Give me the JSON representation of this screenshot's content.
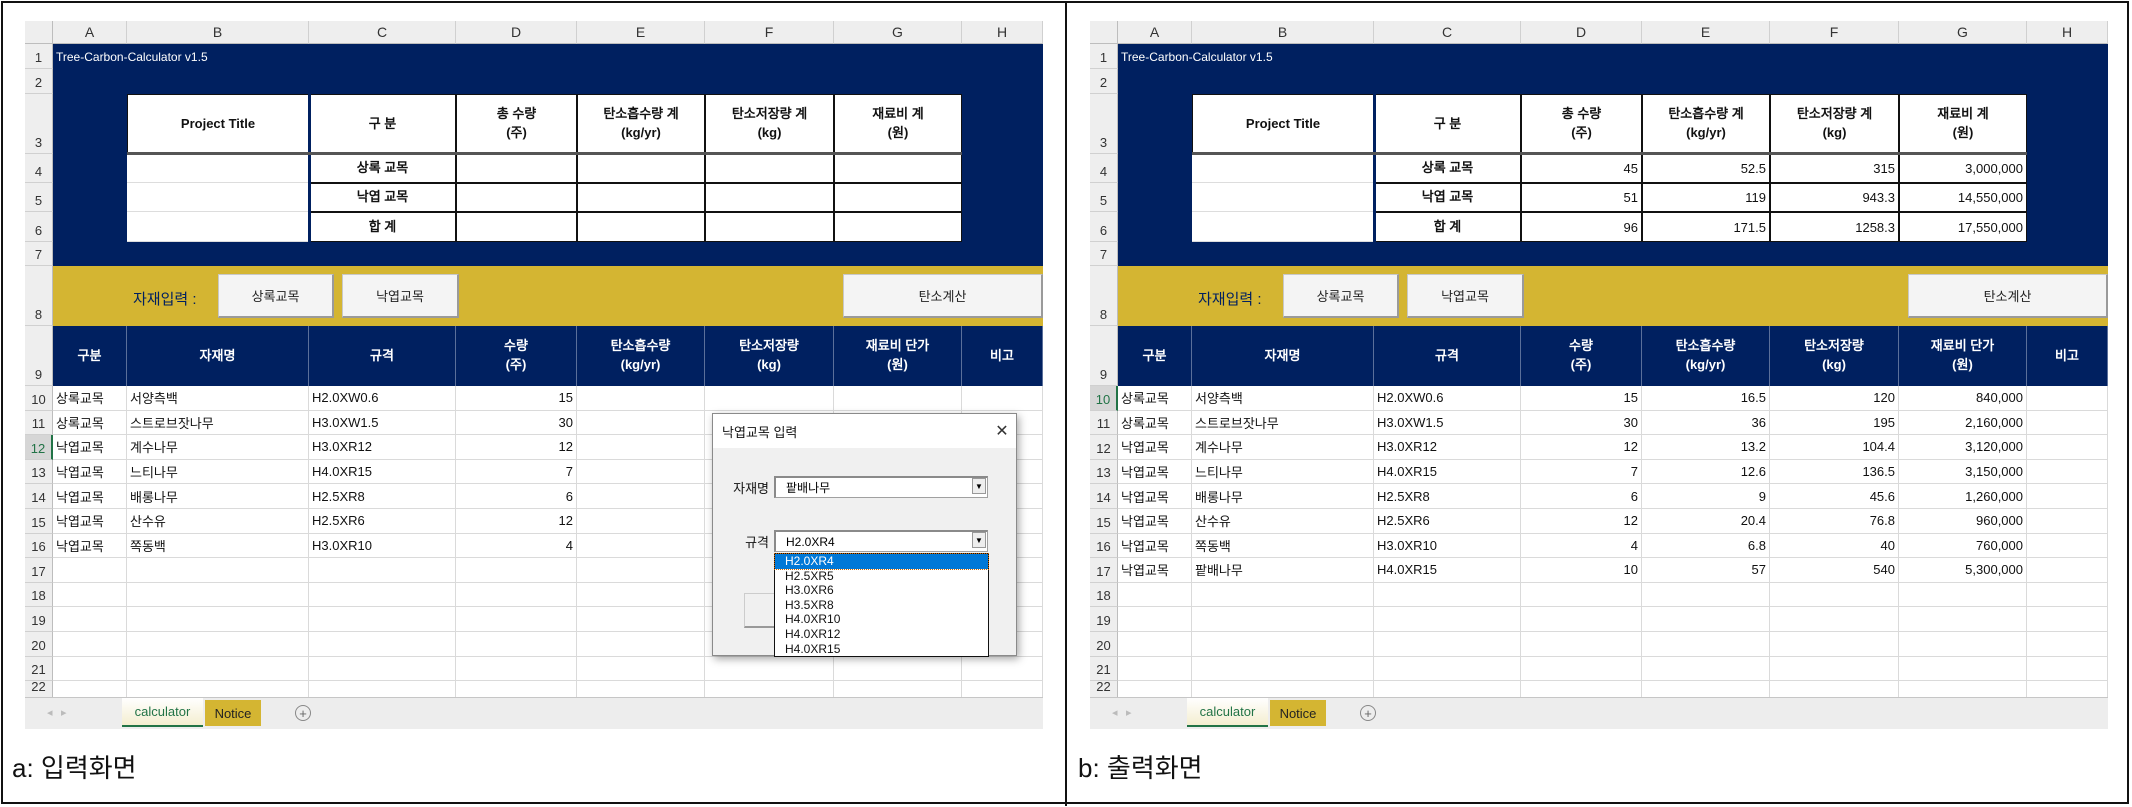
{
  "sheet": {
    "app_title": "Tree-Carbon-Calculator v1.5",
    "column_letters": [
      "A",
      "B",
      "C",
      "D",
      "E",
      "F",
      "G",
      "H"
    ],
    "summary_headers": [
      "Project Title",
      "구 분",
      "총 수량\n(주)",
      "탄소흡수량 계\n(kg/yr)",
      "탄소저장량 계\n(kg)",
      "재료비 계\n(원)"
    ],
    "summary_row_labels": [
      "상록 교목",
      "낙엽 교목",
      "합 계"
    ],
    "input_label": "자재입력 :",
    "buttons": {
      "evergreen": "상록교목",
      "deciduous": "낙엽교목",
      "calculate": "탄소계산"
    },
    "table_headers": [
      "구분",
      "자재명",
      "규격",
      "수량\n(주)",
      "탄소흡수량\n(kg/yr)",
      "탄소저장량\n(kg)",
      "재료비 단가\n(원)",
      "비고"
    ],
    "tabs": [
      "calculator",
      "Notice"
    ],
    "colors": {
      "navy": "#002060",
      "gold": "#d4b532",
      "selection": "#0078d7"
    }
  },
  "panels": [
    {
      "caption": "a: 입력화면",
      "summary_values": [
        [
          "",
          "",
          "",
          ""
        ],
        [
          "",
          "",
          "",
          ""
        ],
        [
          "",
          "",
          "",
          ""
        ]
      ],
      "rows": [
        [
          "상록교목",
          "서양측백",
          "H2.0XW0.6",
          "15",
          "",
          "",
          ""
        ],
        [
          "상록교목",
          "스트로브잣나무",
          "H3.0XW1.5",
          "30",
          "",
          "",
          ""
        ],
        [
          "낙엽교목",
          "계수나무",
          "H3.0XR12",
          "12",
          "",
          "",
          ""
        ],
        [
          "낙엽교목",
          "느티나무",
          "H4.0XR15",
          "7",
          "",
          "",
          ""
        ],
        [
          "낙엽교목",
          "배롱나무",
          "H2.5XR8",
          "6",
          "",
          "",
          ""
        ],
        [
          "낙엽교목",
          "산수유",
          "H2.5XR6",
          "12",
          "",
          "",
          ""
        ],
        [
          "낙엽교목",
          "쪽동백",
          "H3.0XR10",
          "4",
          "",
          "",
          ""
        ]
      ],
      "dialog": {
        "title": "낙엽교목 입력",
        "material_label": "자재명",
        "material_value": "팥배나무",
        "spec_label": "규격",
        "spec_value": "H2.0XR4",
        "spec_options": [
          "H2.0XR4",
          "H2.5XR5",
          "H3.0XR6",
          "H3.5XR8",
          "H4.0XR10",
          "H4.0XR12",
          "H4.0XR15"
        ],
        "selected_option": "H2.0XR4"
      }
    },
    {
      "caption": "b: 출력화면",
      "summary_values": [
        [
          "45",
          "52.5",
          "315",
          "3,000,000"
        ],
        [
          "51",
          "119",
          "943.3",
          "14,550,000"
        ],
        [
          "96",
          "171.5",
          "1258.3",
          "17,550,000"
        ]
      ],
      "rows": [
        [
          "상록교목",
          "서양측백",
          "H2.0XW0.6",
          "15",
          "16.5",
          "120",
          "840,000"
        ],
        [
          "상록교목",
          "스트로브잣나무",
          "H3.0XW1.5",
          "30",
          "36",
          "195",
          "2,160,000"
        ],
        [
          "낙엽교목",
          "계수나무",
          "H3.0XR12",
          "12",
          "13.2",
          "104.4",
          "3,120,000"
        ],
        [
          "낙엽교목",
          "느티나무",
          "H4.0XR15",
          "7",
          "12.6",
          "136.5",
          "3,150,000"
        ],
        [
          "낙엽교목",
          "배롱나무",
          "H2.5XR8",
          "6",
          "9",
          "45.6",
          "1,260,000"
        ],
        [
          "낙엽교목",
          "산수유",
          "H2.5XR6",
          "12",
          "20.4",
          "76.8",
          "960,000"
        ],
        [
          "낙엽교목",
          "쪽동백",
          "H3.0XR10",
          "4",
          "6.8",
          "40",
          "760,000"
        ],
        [
          "낙엽교목",
          "팥배나무",
          "H4.0XR15",
          "10",
          "57",
          "540",
          "5,300,000"
        ]
      ]
    }
  ]
}
